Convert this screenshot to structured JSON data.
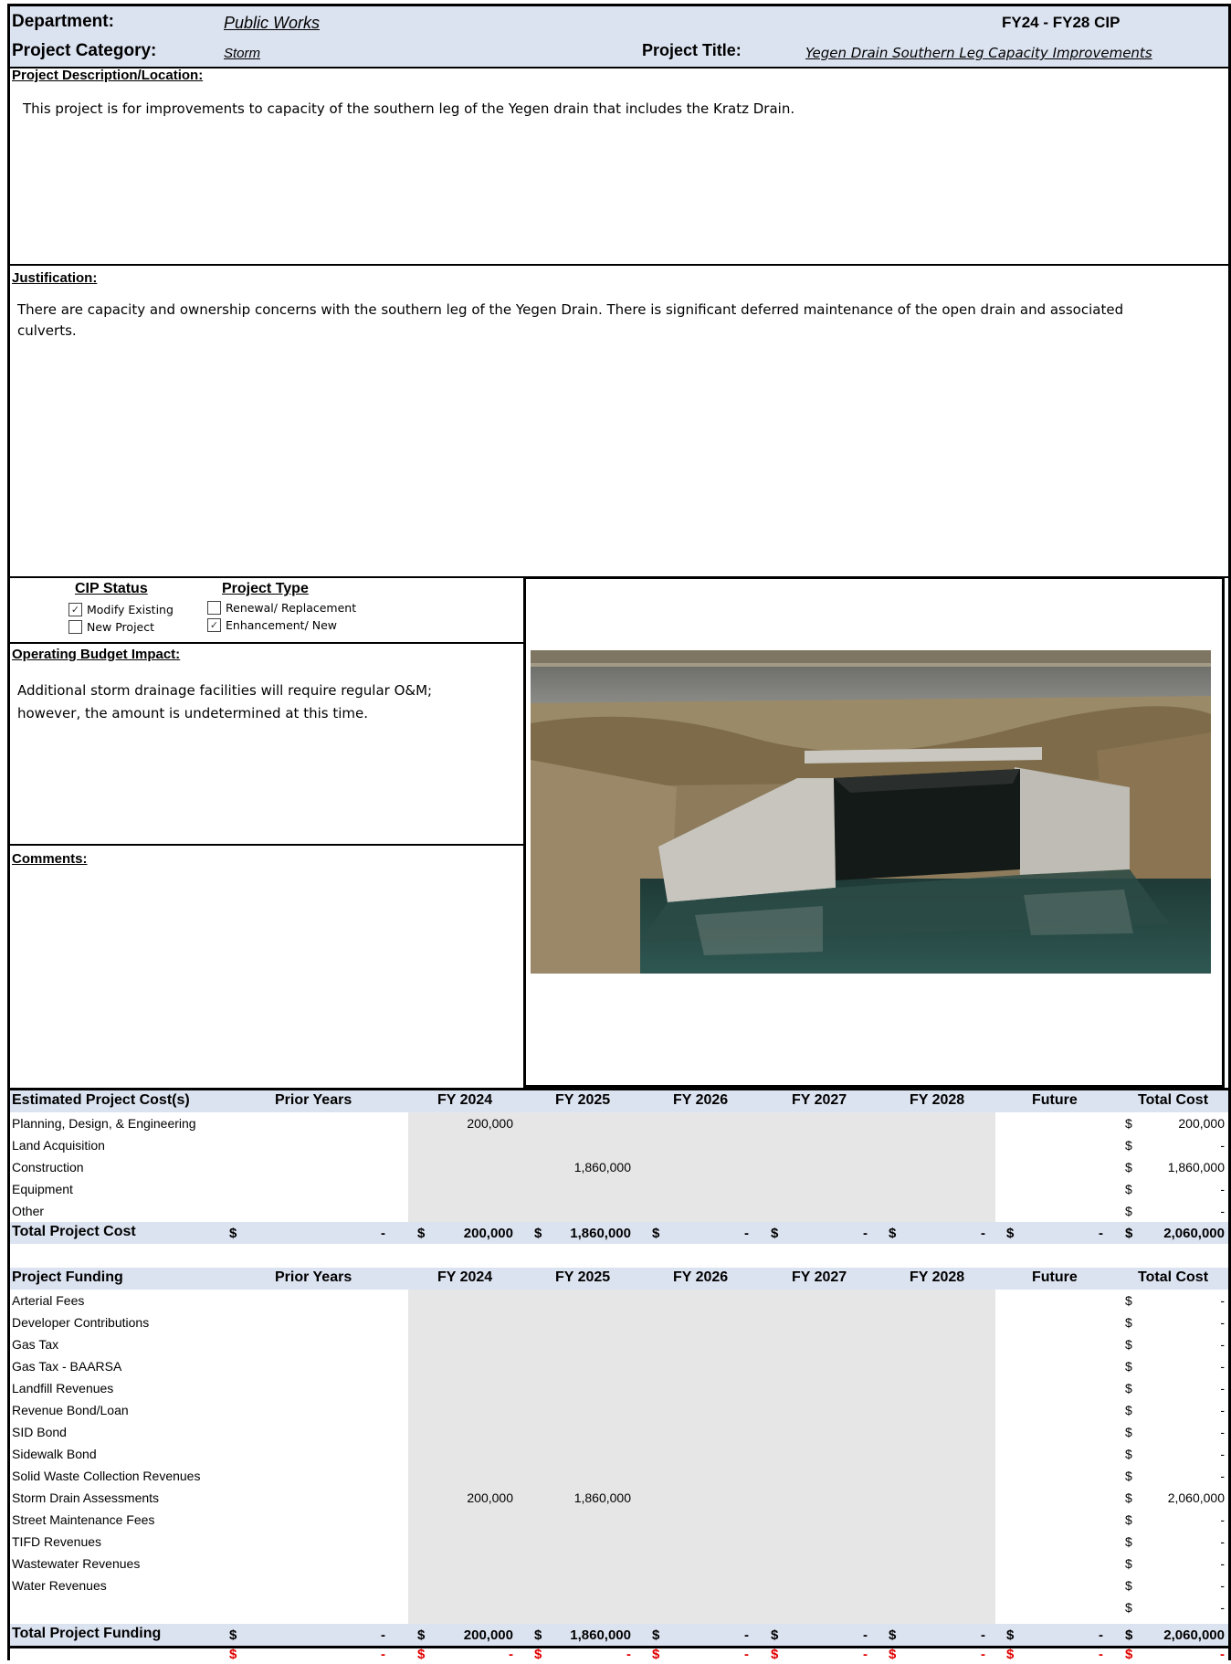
{
  "header": {
    "department_label": "Department:",
    "department_value": "Public Works",
    "cip_label": "FY24 - FY28 CIP",
    "category_label": "Project Category:",
    "category_value": "Storm",
    "title_label": "Project Title:",
    "title_value": "Yegen Drain Southern Leg Capacity Improvements"
  },
  "description": {
    "heading": "Project Description/Location:",
    "text": "This project is for improvements to capacity of the southern leg of the Yegen drain that includes the Kratz Drain."
  },
  "justification": {
    "heading": "Justification:",
    "line1": "There are capacity and ownership concerns with the southern leg of the Yegen Drain. There is significant deferred maintenance of the open drain and associated",
    "line2": "culverts."
  },
  "status": {
    "cip_heading": "CIP Status",
    "type_heading": "Project Type",
    "modify_existing": "Modify Existing",
    "new_project": "New Project",
    "renewal": "Renewal/ Replacement",
    "enhancement": "Enhancement/ New",
    "check": "✓"
  },
  "operating": {
    "heading": "Operating Budget Impact:",
    "line1": "Additional storm drainage facilities will require regular O&M;",
    "line2": "however, the amount is undetermined at this time."
  },
  "comments": {
    "heading": "Comments:"
  },
  "columns": [
    "Prior Years",
    "FY 2024",
    "FY 2025",
    "FY 2026",
    "FY 2027",
    "FY 2028",
    "Future",
    "Total Cost"
  ],
  "cost": {
    "heading": "Estimated Project Cost(s)",
    "rows": [
      {
        "label": "Planning, Design, & Engineering",
        "fy2024": "200,000",
        "fy2025": "",
        "total": "200,000"
      },
      {
        "label": "Land Acquisition",
        "fy2024": "",
        "fy2025": "",
        "total": "-"
      },
      {
        "label": "Construction",
        "fy2024": "",
        "fy2025": "1,860,000",
        "total": "1,860,000"
      },
      {
        "label": "Equipment",
        "fy2024": "",
        "fy2025": "",
        "total": "-"
      },
      {
        "label": "Other",
        "fy2024": "",
        "fy2025": "",
        "total": "-"
      }
    ],
    "total_label": "Total Project Cost",
    "totals": [
      "-",
      "200,000",
      "1,860,000",
      "-",
      "-",
      "-",
      "-",
      "2,060,000"
    ]
  },
  "funding": {
    "heading": "Project Funding",
    "rows": [
      {
        "label": "Arterial Fees",
        "fy2024": "",
        "fy2025": "",
        "total": "-"
      },
      {
        "label": "Developer Contributions",
        "fy2024": "",
        "fy2025": "",
        "total": "-"
      },
      {
        "label": "Gas Tax",
        "fy2024": "",
        "fy2025": "",
        "total": "-"
      },
      {
        "label": "Gas Tax - BAARSA",
        "fy2024": "",
        "fy2025": "",
        "total": "-"
      },
      {
        "label": "Landfill Revenues",
        "fy2024": "",
        "fy2025": "",
        "total": "-"
      },
      {
        "label": "Revenue Bond/Loan",
        "fy2024": "",
        "fy2025": "",
        "total": "-"
      },
      {
        "label": "SID Bond",
        "fy2024": "",
        "fy2025": "",
        "total": "-"
      },
      {
        "label": "Sidewalk Bond",
        "fy2024": "",
        "fy2025": "",
        "total": "-"
      },
      {
        "label": "Solid Waste Collection Revenues",
        "fy2024": "",
        "fy2025": "",
        "total": "-"
      },
      {
        "label": "Storm Drain Assessments",
        "fy2024": "200,000",
        "fy2025": "1,860,000",
        "total": "2,060,000"
      },
      {
        "label": "Street Maintenance Fees",
        "fy2024": "",
        "fy2025": "",
        "total": "-"
      },
      {
        "label": "TIFD Revenues",
        "fy2024": "",
        "fy2025": "",
        "total": "-"
      },
      {
        "label": "Wastewater Revenues",
        "fy2024": "",
        "fy2025": "",
        "total": "-"
      },
      {
        "label": "Water Revenues",
        "fy2024": "",
        "fy2025": "",
        "total": "-"
      },
      {
        "label": "",
        "fy2024": "",
        "fy2025": "",
        "total": "-"
      }
    ],
    "total_label": "Total Project Funding",
    "totals": [
      "-",
      "200,000",
      "1,860,000",
      "-",
      "-",
      "-",
      "-",
      "2,060,000"
    ]
  },
  "variance": [
    "-",
    "-",
    "-",
    "-",
    "-",
    "-",
    "-",
    "-"
  ],
  "currency": "$"
}
